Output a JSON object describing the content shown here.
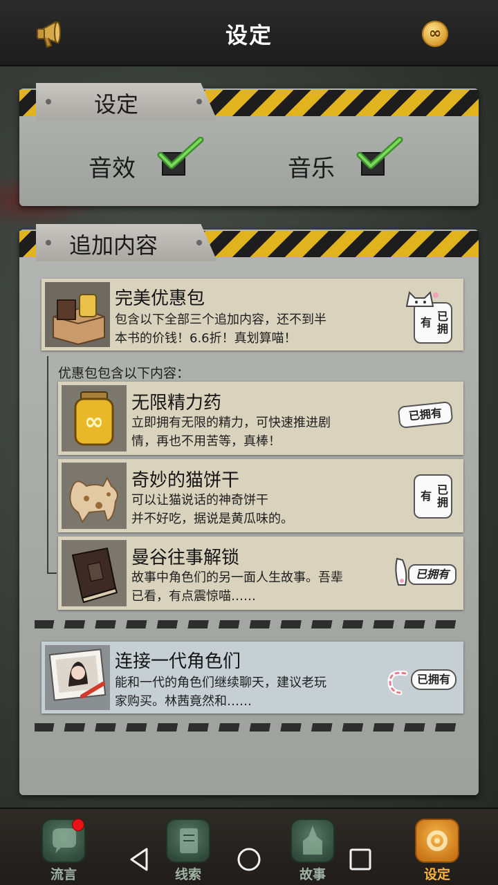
{
  "header": {
    "title": "设定",
    "left_icon": "megaphone-icon",
    "right_icon": "infinity-coin-icon"
  },
  "settings": {
    "section_title": "设定",
    "options": [
      {
        "label": "音效",
        "checked": true
      },
      {
        "label": "音乐",
        "checked": true
      }
    ]
  },
  "addons": {
    "section_title": "追加内容",
    "bundle": {
      "title": "完美优惠包",
      "desc_line1": "包含以下全部三个追加内容，还不到半",
      "desc_line2": "本书的价钱！6.6折！真划算喵！",
      "status": "已拥有"
    },
    "includes_label": "优惠包包含以下内容：",
    "items": [
      {
        "title": "无限精力药",
        "desc_line1": "立即拥有无限的精力，可快速推进剧",
        "desc_line2": "情，再也不用苦等，真棒！",
        "status": "已拥有"
      },
      {
        "title": "奇妙的猫饼干",
        "desc_line1": "可以让猫说话的神奇饼干",
        "desc_line2": "并不好吃，据说是黄瓜味的。",
        "status": "已拥有"
      },
      {
        "title": "曼谷往事解锁",
        "desc_line1": "故事中角色们的另一面人生故事。吾辈",
        "desc_line2": "已看，有点震惊喵……",
        "status": "已拥有"
      }
    ],
    "connect": {
      "title": "连接一代角色们",
      "desc_line1": "能和一代的角色们继续聊天，建议老玩",
      "desc_line2": "家购买。林茜竟然和……",
      "status": "已拥有"
    }
  },
  "bottom_nav": {
    "items": [
      {
        "label": "流言",
        "icon": "chat-bubble-icon",
        "badge": true
      },
      {
        "label": "线索",
        "icon": "scroll-icon"
      },
      {
        "label": "故事",
        "icon": "temple-icon"
      },
      {
        "label": "设定",
        "icon": "gear-icon",
        "active": true
      }
    ]
  },
  "colors": {
    "accent": "#ffb340",
    "hazard_yellow": "#e0b31f",
    "badge_red": "#e8141a"
  }
}
